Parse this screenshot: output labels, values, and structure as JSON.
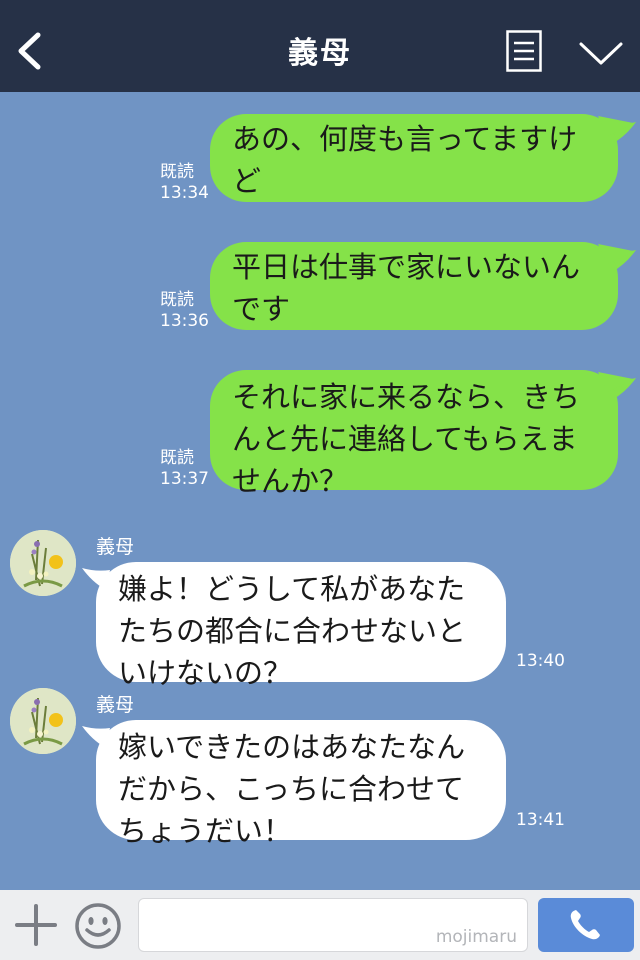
{
  "header": {
    "title": "義母"
  },
  "messages_out": [
    {
      "lines": [
        "あの、何度も言ってますけ",
        "ど"
      ],
      "read": "既読",
      "time": "13:34"
    },
    {
      "lines": [
        "平日は仕事で家にいないん",
        "です"
      ],
      "read": "既読",
      "time": "13:36"
    },
    {
      "lines": [
        "それに家に来るなら、きち",
        "んと先に連絡してもらえま",
        "せんか？"
      ],
      "read": "既読",
      "time": "13:37"
    }
  ],
  "messages_in": [
    {
      "sender": "義母",
      "lines": [
        "嫌よ！どうして私があなた",
        "たちの都合に合わせないと",
        "いけないの？"
      ],
      "time": "13:40"
    },
    {
      "sender": "義母",
      "lines": [
        "嫁いできたのはあなたなん",
        "だから、こっちに合わせて",
        "ちょうだい！"
      ],
      "time": "13:41"
    }
  ],
  "footer": {
    "watermark": "mojimaru"
  },
  "colors": {
    "header": "#263147",
    "background": "#7094c4",
    "bubble_mine": "#85e249",
    "bubble_theirs": "#ffffff",
    "call_button": "#5a8bd8"
  }
}
